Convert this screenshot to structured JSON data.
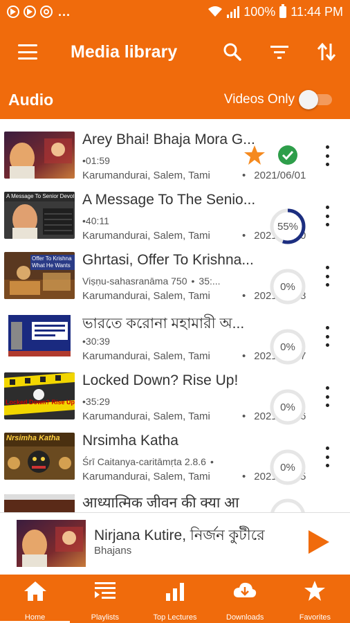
{
  "status_bar": {
    "battery": "100%",
    "time": "11:44 PM",
    "overflow": "..."
  },
  "app_bar": {
    "title": "Media library",
    "actions": [
      "search-icon",
      "filter-icon",
      "sort-icon"
    ]
  },
  "sub_bar": {
    "title": "Audio",
    "videos_only_label": "Videos Only",
    "videos_only_on": false
  },
  "colors": {
    "accent": "#f06b0c",
    "progress": "#1c2e80",
    "check": "#2e9e4a",
    "star": "#f58a1f"
  },
  "items": [
    {
      "title": "Arey Bhai! Bhaja Mora G...",
      "meta": "01:59",
      "location": "Karumandurai, Salem, Tami",
      "date": "2021/06/01",
      "favorite": true,
      "completed": true
    },
    {
      "title": "A Message To The Senio...",
      "meta": "40:11",
      "location": "Karumandurai, Salem, Tami",
      "date": "2021/05/30",
      "progress_label": "55%",
      "progress": 0.55
    },
    {
      "title": "Ghrtasi, Offer To Krishna...",
      "meta": "Viṣṇu-sahasranāma 750",
      "meta2": "35:...",
      "location": "Karumandurai, Salem, Tami",
      "date": "2021/05/28",
      "progress_label": "0%",
      "progress": 0
    },
    {
      "title": "ভারতে করোনা মহামারী অ...",
      "meta": "30:39",
      "location": "Karumandurai, Salem, Tami",
      "date": "2021/05/27",
      "progress_label": "0%",
      "progress": 0
    },
    {
      "title": "Locked Down? Rise Up!",
      "meta": "35:29",
      "location": "Karumandurai, Salem, Tami",
      "date": "2021/05/26",
      "progress_label": "0%",
      "progress": 0
    },
    {
      "title": "Nrsimha Katha",
      "meta": "Śrī Caitanya-caritāmṛta 2.8.6",
      "location": "Karumandurai, Salem, Tami",
      "date": "2021/05/25",
      "progress_label": "0%",
      "progress": 0
    },
    {
      "title": "आध्यात्मिक जीवन की क्या आ"
    }
  ],
  "thumb_text": {
    "t2": "A Message To Senior Devotees",
    "t3": "Offer To Krishna What He Wants",
    "t5": "Locked Down? Rise Up!",
    "t6": "Nrsimha Katha"
  },
  "mini_player": {
    "title": "Nirjana Kutire, নির্জন কুটীরে",
    "subtitle": "Bhajans"
  },
  "nav": [
    {
      "label": "Home",
      "icon": "home-icon",
      "active": true
    },
    {
      "label": "Playlists",
      "icon": "playlist-icon"
    },
    {
      "label": "Top Lectures",
      "icon": "chart-icon"
    },
    {
      "label": "Downloads",
      "icon": "download-icon"
    },
    {
      "label": "Favorites",
      "icon": "star-icon"
    }
  ]
}
